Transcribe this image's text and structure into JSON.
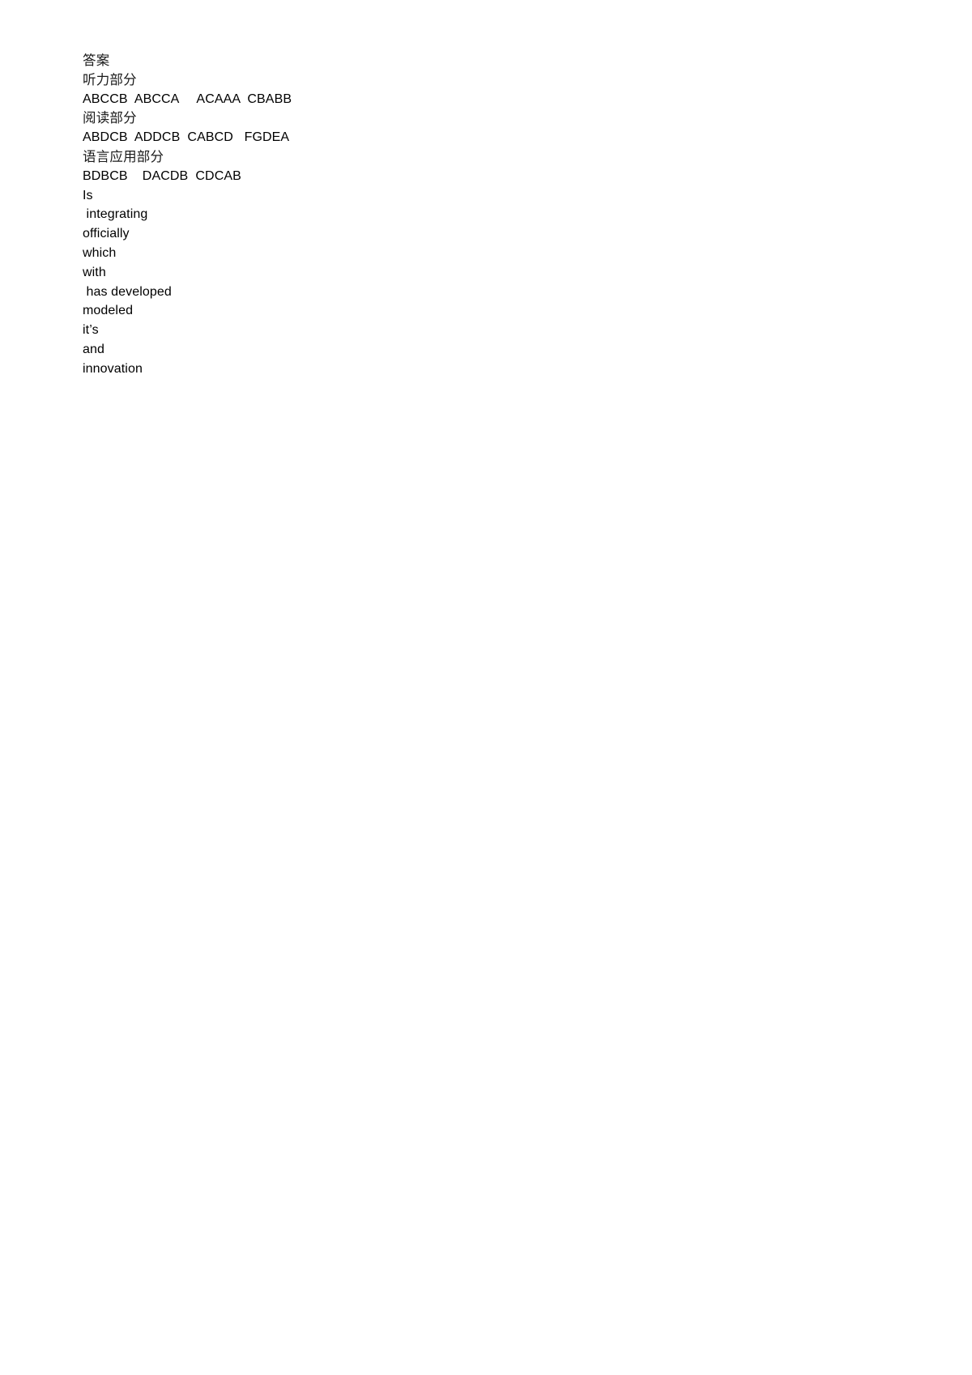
{
  "document": {
    "background_color": "#ffffff",
    "text_color": "#000000",
    "lines": [
      {
        "text": "答案",
        "script": "cjk"
      },
      {
        "text": "听力部分",
        "script": "cjk"
      },
      {
        "text": "ABCCB  ABCCA     ACAAA  CBABB",
        "script": "latin"
      },
      {
        "text": "阅读部分",
        "script": "cjk"
      },
      {
        "text": "ABDCB  ADDCB  CABCD   FGDEA",
        "script": "latin"
      },
      {
        "text": "语言应用部分",
        "script": "cjk"
      },
      {
        "text": "BDBCB    DACDB  CDCAB",
        "script": "latin"
      },
      {
        "text": "Is",
        "script": "latin"
      },
      {
        "text": " integrating",
        "script": "latin"
      },
      {
        "text": "officially",
        "script": "latin"
      },
      {
        "text": "which",
        "script": "latin"
      },
      {
        "text": "with",
        "script": "latin"
      },
      {
        "text": " has developed",
        "script": "latin"
      },
      {
        "text": "modeled",
        "script": "latin"
      },
      {
        "text": "it’s",
        "script": "latin"
      },
      {
        "text": "and",
        "script": "latin"
      },
      {
        "text": "innovation",
        "script": "latin"
      }
    ]
  },
  "sections": {
    "title": "答案",
    "listening_heading": "听力部分",
    "listening_answers": "ABCCB  ABCCA     ACAAA  CBABB",
    "reading_heading": "阅读部分",
    "reading_answers": "ABDCB  ADDCB  CABCD   FGDEA",
    "language_use_heading": "语言应用部分",
    "language_use_answers": "BDBCB    DACDB  CDCAB",
    "fill_in_answers": [
      "Is",
      " integrating",
      "officially",
      "which",
      "with",
      " has developed",
      "modeled",
      "it’s",
      "and",
      "innovation"
    ]
  }
}
